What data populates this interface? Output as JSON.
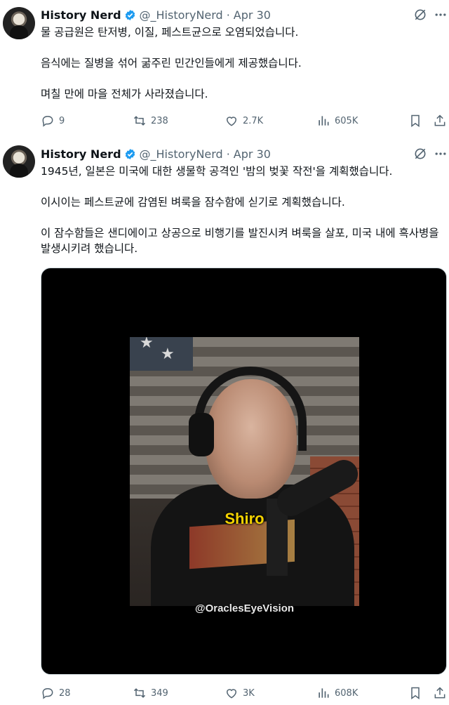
{
  "tweets": [
    {
      "author_name": "History Nerd",
      "handle": "@_HistoryNerd",
      "separator": "·",
      "date": "Apr 30",
      "paragraphs": [
        "물 공급원은 탄저병, 이질, 페스트균으로 오염되었습니다.",
        "음식에는 질병을 섞어 굶주린 민간인들에게 제공했습니다.",
        "며칠 만에 마을 전체가 사라졌습니다."
      ],
      "replies": "9",
      "reposts": "238",
      "likes": "2.7K",
      "views": "605K"
    },
    {
      "author_name": "History Nerd",
      "handle": "@_HistoryNerd",
      "separator": "·",
      "date": "Apr 30",
      "paragraphs": [
        "1945년, 일본은 미국에 대한 생물학 공격인 '밤의 벚꽃 작전'을 계획했습니다.",
        "이시이는 페스트균에 감염된 벼룩을 잠수함에 싣기로 계획했습니다.",
        "이 잠수함들은 샌디에이고 상공으로 비행기를 발진시켜 벼룩을 살포, 미국 내에 흑사병을 발생시키려 했습니다."
      ],
      "video": {
        "caption": "Shiro",
        "watermark": "@OraclesEyeVision"
      },
      "replies": "28",
      "reposts": "349",
      "likes": "3K",
      "views": "608K"
    }
  ],
  "colors": {
    "text": "#0f1419",
    "secondary": "#536471",
    "verified": "#1d9bf0",
    "caption": "#f5d300"
  },
  "icons": [
    "verified-badge-icon",
    "grok-icon",
    "more-icon",
    "reply-icon",
    "repost-icon",
    "like-icon",
    "views-icon",
    "bookmark-icon",
    "share-icon"
  ]
}
